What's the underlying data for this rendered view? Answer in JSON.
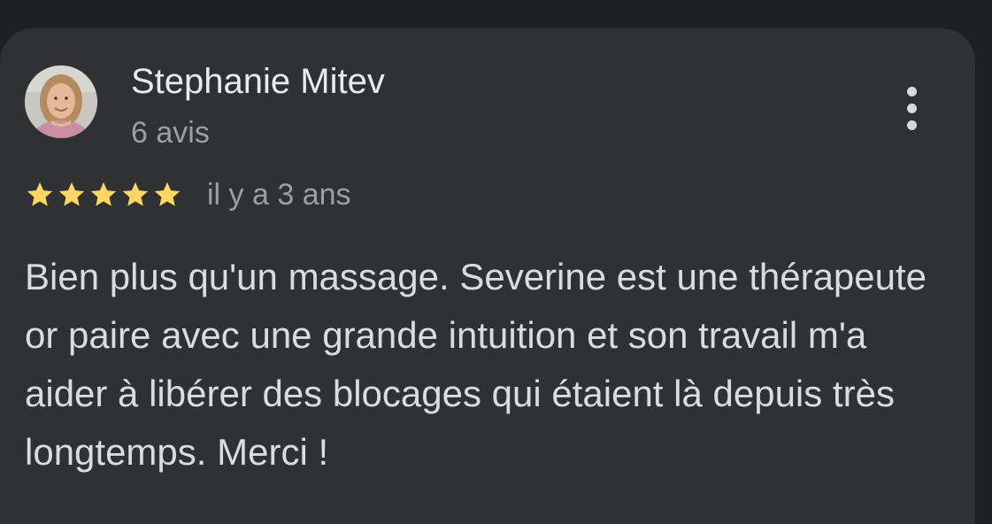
{
  "review": {
    "reviewer_name": "Stephanie Mitev",
    "review_count": "6 avis",
    "rating": 5,
    "rating_max": 5,
    "date": "il y a 3 ans",
    "text": "Bien plus qu'un massage. Severine est une thérapeute or paire avec une grande intuition et son travail m'a aider à libérer des blocages qui étaient là depuis très longtemps. Merci !"
  },
  "icons": {
    "avatar": "reviewer-avatar",
    "star": "star-icon",
    "more": "more-vert-icon"
  },
  "colors": {
    "background": "#1f2021",
    "card": "#2f3133",
    "star": "#fdd663",
    "primary_text": "#e8eaed",
    "secondary_text": "#9aa0a6"
  }
}
